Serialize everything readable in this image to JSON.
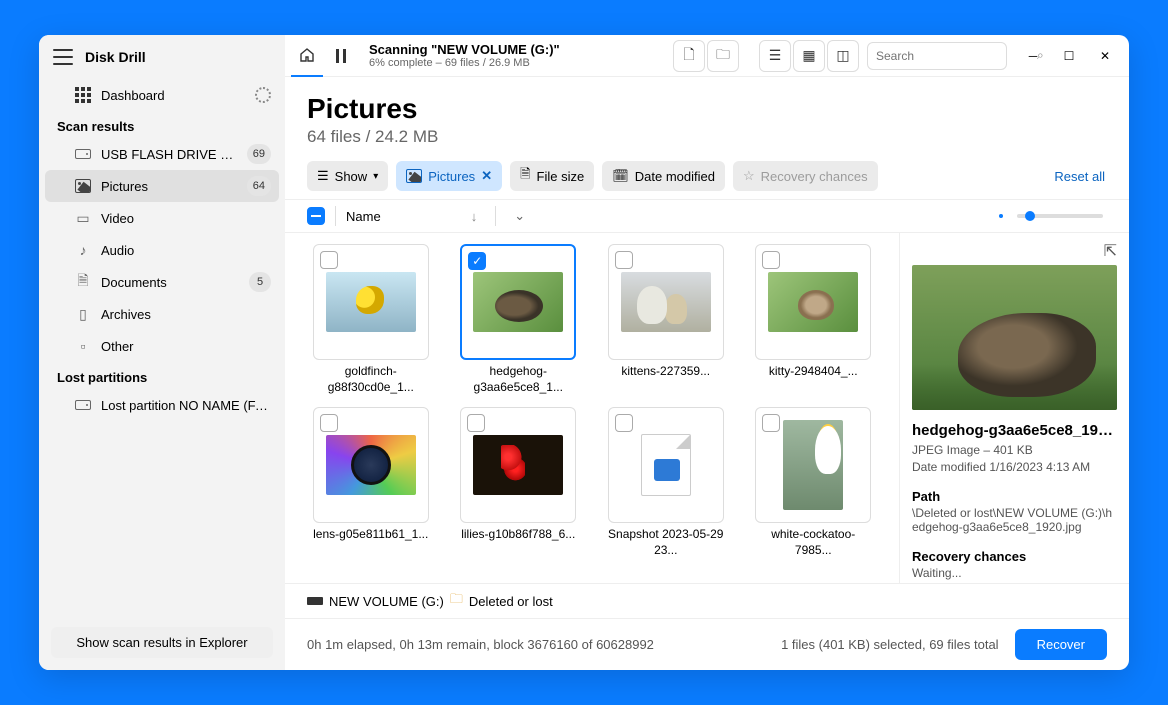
{
  "app": {
    "title": "Disk Drill"
  },
  "sidebar": {
    "dashboard": "Dashboard",
    "scan_results": "Scan results",
    "usb": {
      "label": "USB FLASH DRIVE USB D...",
      "count": "69"
    },
    "pictures": {
      "label": "Pictures",
      "count": "64"
    },
    "video": "Video",
    "audio": "Audio",
    "documents": {
      "label": "Documents",
      "count": "5"
    },
    "archives": "Archives",
    "other": "Other",
    "lost_partitions": "Lost partitions",
    "lost_partition": "Lost partition NO NAME (FAT...)"
  },
  "titlebar": {
    "scan_title": "Scanning \"NEW VOLUME (G:)\"",
    "scan_sub": "6% complete – 69 files / 26.9 MB",
    "search_placeholder": "Search"
  },
  "header": {
    "title": "Pictures",
    "sub": "64 files / 24.2 MB"
  },
  "toolbar": {
    "show": "Show",
    "pictures": "Pictures",
    "file_size": "File size",
    "date_modified": "Date modified",
    "recovery_chances": "Recovery chances",
    "reset": "Reset all"
  },
  "list": {
    "name": "Name"
  },
  "files": [
    {
      "name": "goldfinch-g88f30cd0e_1..."
    },
    {
      "name": "hedgehog-g3aa6e5ce8_1..."
    },
    {
      "name": "kittens-227359..."
    },
    {
      "name": "kitty-2948404_..."
    },
    {
      "name": "lens-g05e811b61_1..."
    },
    {
      "name": "lilies-g10b86f788_6..."
    },
    {
      "name": "Snapshot 2023-05-29 23..."
    },
    {
      "name": "white-cockatoo-7985..."
    }
  ],
  "preview": {
    "name": "hedgehog-g3aa6e5ce8_192...",
    "type_size": "JPEG Image – 401 KB",
    "modified": "Date modified 1/16/2023 4:13 AM",
    "path_h": "Path",
    "path": "\\Deleted or lost\\NEW VOLUME (G:)\\hedgehog-g3aa6e5ce8_1920.jpg",
    "chances_h": "Recovery chances",
    "chances": "Waiting..."
  },
  "breadcrumb": {
    "drive": "NEW VOLUME (G:)",
    "folder": "Deleted or lost"
  },
  "bottom": {
    "explorer": "Show scan results in Explorer",
    "status": "0h 1m elapsed, 0h 13m remain, block 3676160 of 60628992",
    "selection": "1 files (401 KB) selected, 69 files total",
    "recover": "Recover"
  }
}
